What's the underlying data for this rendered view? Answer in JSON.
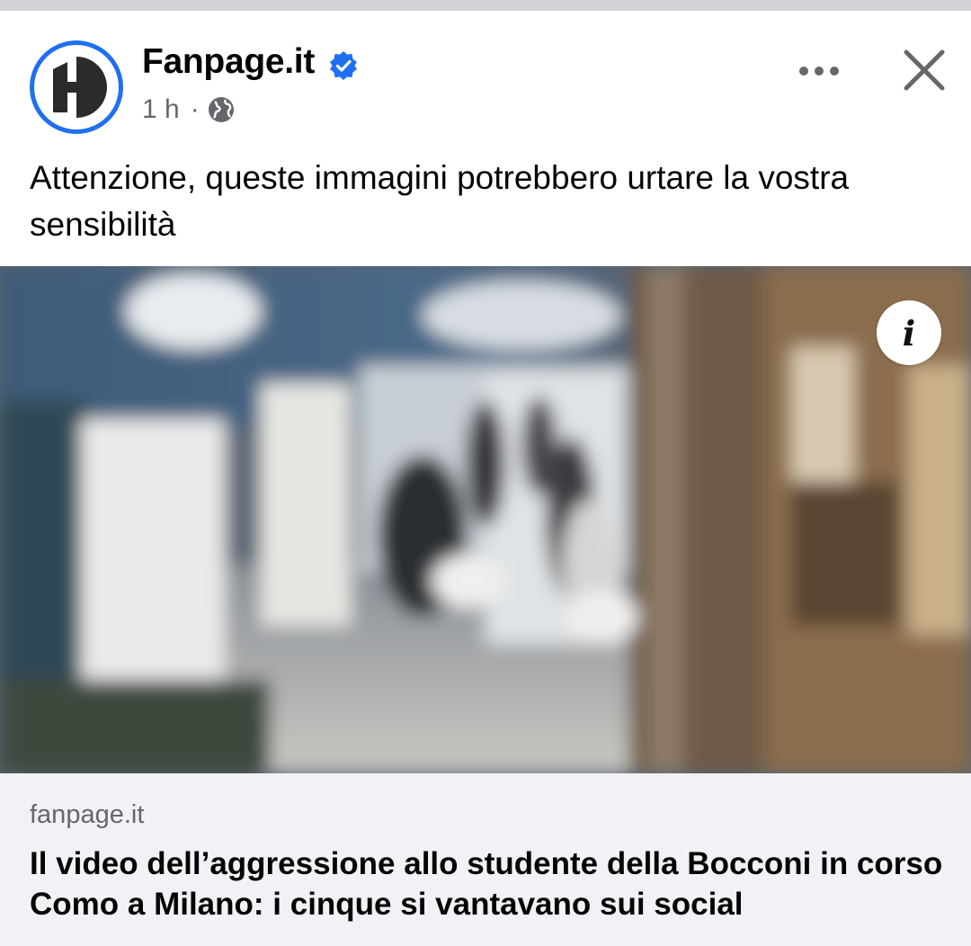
{
  "post": {
    "page_name": "Fanpage.it",
    "time": "1 h",
    "separator": "·",
    "audience_icon": "globe-icon",
    "verified_icon": "verified-badge-icon",
    "text": "Attenzione, queste immagini potrebbero urtare la vostra sensibilità"
  },
  "actions": {
    "more_icon": "more-horizontal-icon",
    "close_icon": "close-icon",
    "info_glyph": "i"
  },
  "link_card": {
    "domain": "fanpage.it",
    "title": "Il video dell’aggressione allo studente della Bocconi in corso Como a Milano: i cinque si vantavano sui social"
  },
  "colors": {
    "accent": "#1f6ff0",
    "text_primary": "#050505",
    "text_secondary": "#65676b",
    "card_background": "#f0f2f5"
  }
}
